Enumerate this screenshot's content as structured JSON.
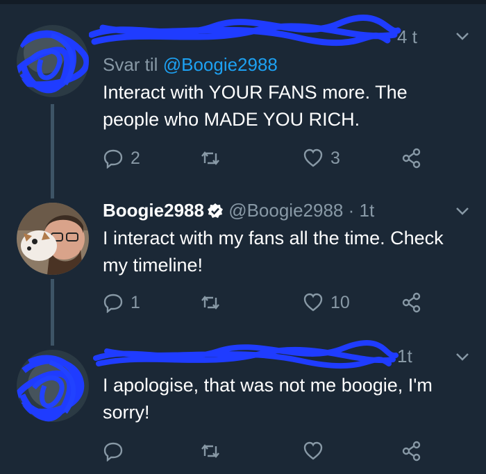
{
  "tweets": [
    {
      "reply_prefix": "Svar til",
      "reply_to": "@Boogie2988",
      "time": "4 t",
      "text": "Interact with YOUR FANS more. The people who MADE YOU RICH.",
      "replies": "2",
      "retweets": "",
      "likes": "3"
    },
    {
      "name": "Boogie2988",
      "handle": "@Boogie2988",
      "time": "· 1t",
      "text": "I interact with my fans all the time. Check my timeline!",
      "replies": "1",
      "retweets": "",
      "likes": "10"
    },
    {
      "time": "1t",
      "text": "I apologise, that was not me boogie, I'm sorry!",
      "replies": "",
      "retweets": "",
      "likes": ""
    }
  ],
  "colors": {
    "background": "#1b2836",
    "muted": "#8899a6",
    "link": "#1da1f2",
    "scribble": "#1f3cff",
    "verified": "#ffffff"
  },
  "icons": [
    "reply-icon",
    "retweet-icon",
    "like-icon",
    "share-icon",
    "chevron-down-icon",
    "verified-badge-icon"
  ]
}
